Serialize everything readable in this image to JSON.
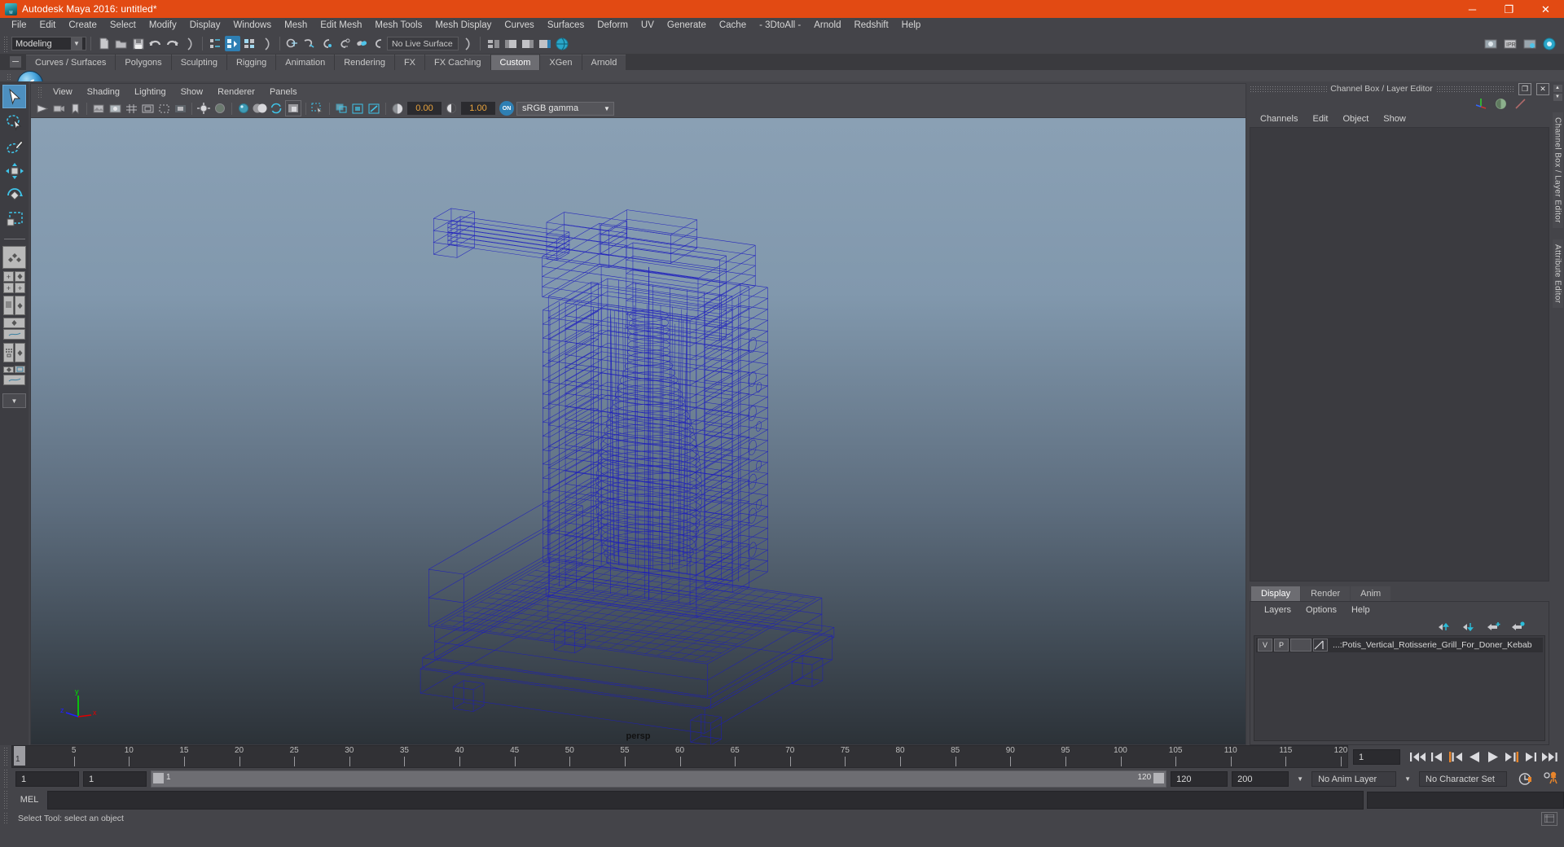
{
  "window": {
    "title": "Autodesk Maya 2016: untitled*",
    "minimize": "─",
    "maximize": "❐",
    "close": "✕",
    "accent": "#e24a13"
  },
  "menubar": {
    "items": [
      "File",
      "Edit",
      "Create",
      "Select",
      "Modify",
      "Display",
      "Windows",
      "Mesh",
      "Edit Mesh",
      "Mesh Tools",
      "Mesh Display",
      "Curves",
      "Surfaces",
      "Deform",
      "UV",
      "Generate",
      "Cache",
      "- 3DtoAll -",
      "Arnold",
      "Redshift",
      "Help"
    ]
  },
  "statusbar": {
    "menuset": "Modeling",
    "live_surface": "No Live Surface"
  },
  "shelf": {
    "tabs": [
      {
        "label": "Curves / Surfaces",
        "active": false
      },
      {
        "label": "Polygons",
        "active": false
      },
      {
        "label": "Sculpting",
        "active": false
      },
      {
        "label": "Rigging",
        "active": false
      },
      {
        "label": "Animation",
        "active": false
      },
      {
        "label": "Rendering",
        "active": false
      },
      {
        "label": "FX",
        "active": false
      },
      {
        "label": "FX Caching",
        "active": false
      },
      {
        "label": "Custom",
        "active": true
      },
      {
        "label": "XGen",
        "active": false
      },
      {
        "label": "Arnold",
        "active": false
      }
    ],
    "collapse_glyph": "─",
    "custom_icon_glyph": "✔"
  },
  "toolbox": {
    "tools": [
      {
        "name": "select-tool",
        "selected": true
      },
      {
        "name": "lasso-select-tool",
        "selected": false
      },
      {
        "name": "paint-select-tool",
        "selected": false
      },
      {
        "name": "move-tool",
        "selected": false
      },
      {
        "name": "rotate-tool",
        "selected": false
      },
      {
        "name": "scale-tool",
        "selected": false
      }
    ],
    "layout_arrow": "▼"
  },
  "viewport": {
    "panel_menu": [
      "View",
      "Shading",
      "Lighting",
      "Show",
      "Renderer",
      "Panels"
    ],
    "camera_label": "persp",
    "exposure": "0.00",
    "gamma": "1.00",
    "color_mgmt_toggle": "ON",
    "color_profile": "sRGB gamma",
    "axis": {
      "x": "x",
      "y": "y",
      "z": "z"
    },
    "wireframe_color": "#1d1dbe",
    "bg_top": "#8aa0b4",
    "bg_bottom": "#2c3238"
  },
  "channelbox": {
    "panel_title": "Channel Box / Layer Editor",
    "undock_glyph": "❐",
    "close_glyph": "✕",
    "menu": [
      "Channels",
      "Edit",
      "Object",
      "Show"
    ],
    "side_tabs": [
      "Channel Box / Layer Editor",
      "Attribute Editor"
    ]
  },
  "layer_editor": {
    "tabs": [
      {
        "label": "Display",
        "active": true
      },
      {
        "label": "Render",
        "active": false
      },
      {
        "label": "Anim",
        "active": false
      }
    ],
    "menu": [
      "Layers",
      "Options",
      "Help"
    ],
    "columns": {
      "visibility": "V",
      "playback": "P"
    },
    "layers": [
      {
        "v": "V",
        "p": "P",
        "name": "...:Potis_Vertical_Rotisserie_Grill_For_Doner_Kebab"
      }
    ]
  },
  "timeline": {
    "start_label": "1",
    "ticks": [
      5,
      10,
      15,
      20,
      25,
      30,
      35,
      40,
      45,
      50,
      55,
      60,
      65,
      70,
      75,
      80,
      85,
      90,
      95,
      100,
      105,
      110,
      115,
      120
    ],
    "current_frame": "1",
    "playhead_frame": "1",
    "range_start": "1",
    "range_end": "1",
    "anim_start": "1",
    "anim_end": "120",
    "playback_end": "120",
    "total_end": "200",
    "anim_layer": "No Anim Layer",
    "character_set": "No Character Set"
  },
  "command_line": {
    "label": "MEL",
    "value": "",
    "placeholder": ""
  },
  "help_line": {
    "text": "Select Tool: select an object"
  }
}
